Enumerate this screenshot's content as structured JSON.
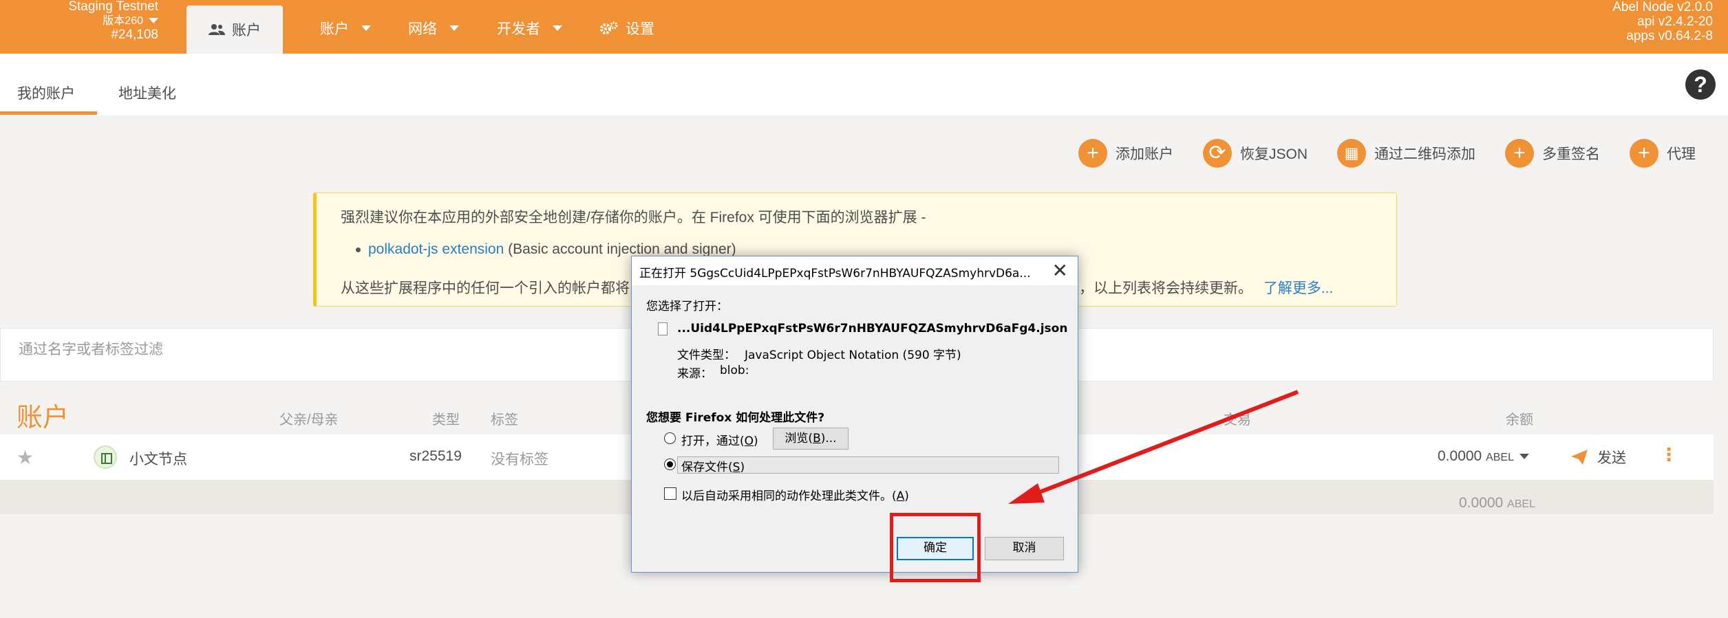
{
  "topbar": {
    "chain_name": "Staging Testnet",
    "chain_version": "版本260",
    "block_number": "#24,108",
    "active_tab": "账户",
    "nav": [
      {
        "label": "账户"
      },
      {
        "label": "网络"
      },
      {
        "label": "开发者"
      },
      {
        "label": "设置"
      }
    ],
    "node_name": "Abel Node v2.0.0",
    "api_version": "api v2.4.2-20",
    "apps_version": "apps v0.64.2-8"
  },
  "subtabs": [
    {
      "label": "我的账户"
    },
    {
      "label": "地址美化"
    }
  ],
  "help_symbol": "?",
  "actions": [
    {
      "label": "添加账户",
      "icon": "plus-icon"
    },
    {
      "label": "恢复JSON",
      "icon": "sync-icon"
    },
    {
      "label": "通过二维码添加",
      "icon": "qrcode-icon"
    },
    {
      "label": "多重签名",
      "icon": "plus-icon"
    },
    {
      "label": "代理",
      "icon": "plus-icon"
    }
  ],
  "banner": {
    "line1": "强烈建议你在本应用的外部安全地创建/存储你的账户。在 Firefox 可使用下面的浏览器扩展 -",
    "ext_link": "polkadot-js extension",
    "ext_desc": " (Basic account injection and signer)",
    "line3_start": "从这些扩展程序中的任何一个引入的帐户都将",
    "line3_end": "得可用，以上列表将会持续更新。",
    "learn_more": "了解更多..."
  },
  "filter": {
    "placeholder": "通过名字或者标签过滤"
  },
  "table": {
    "title": "账户",
    "headers": {
      "parent": "父亲/母亲",
      "type": "类型",
      "tags": "标签",
      "transactions": "交易",
      "balance": "余额"
    },
    "rows": [
      {
        "name": "小文节点",
        "type": "sr25519",
        "tags": "没有标签",
        "balance": "0.0000",
        "unit": "ABEL",
        "send": "发送"
      }
    ],
    "total": "0.0000",
    "total_unit": "ABEL"
  },
  "dialog": {
    "title": "正在打开 5GgsCcUid4LPpEPxqFstPsW6r7nHBYAUFQZASmyhrvD6a...",
    "chose_label": "您选择了打开：",
    "filename": "...Uid4LPpEPxqFstPsW6r7nHBYAUFQZASmyhrvD6aFg4.json",
    "filetype_label": "文件类型：",
    "filetype_value": "JavaScript Object Notation (590 字节)",
    "source_label": "来源：",
    "source_value": "blob:",
    "question": "您想要 Firefox 如何处理此文件?",
    "open_with": "打开，通过(",
    "open_with_key": "O",
    "open_with_end": ")",
    "browse_label": "浏览(",
    "browse_key": "B",
    "browse_end": ")...",
    "save_file": "保存文件(",
    "save_file_key": "S",
    "save_file_end": ")",
    "auto_action": "以后自动采用相同的动作处理此类文件。(",
    "auto_action_key": "A",
    "auto_action_end": ")",
    "ok_label": "确定",
    "cancel_label": "取消",
    "selected_option": "save"
  },
  "colors": {
    "brand": "#f19135",
    "annotation_red": "#e21b1b",
    "link": "#2a7dc1"
  }
}
